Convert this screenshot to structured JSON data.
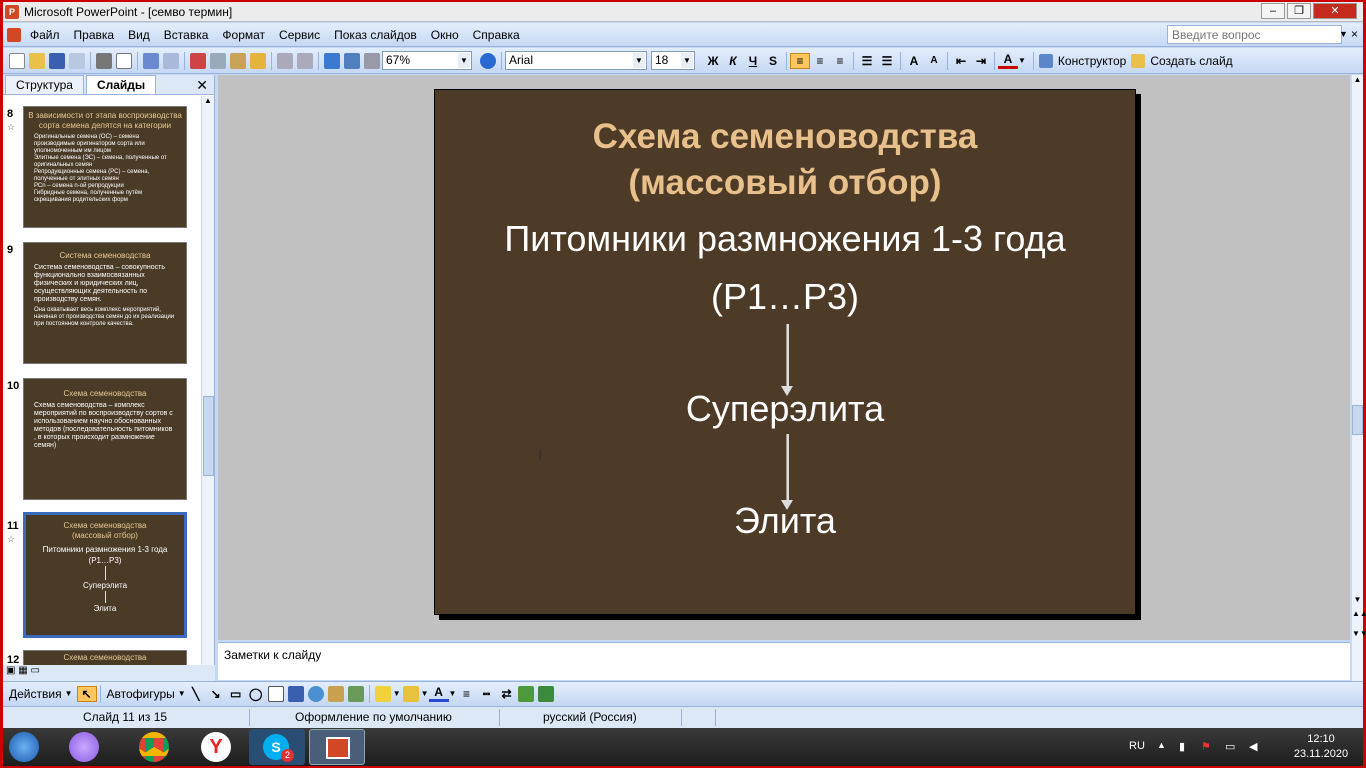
{
  "window": {
    "title": "Microsoft PowerPoint - [семво термин]",
    "app_icon": "powerpoint-icon"
  },
  "window_controls": {
    "minimize": "–",
    "restore": "❐",
    "close": "✕"
  },
  "menubar": {
    "items": [
      "Файл",
      "Правка",
      "Вид",
      "Вставка",
      "Формат",
      "Сервис",
      "Показ слайдов",
      "Окно",
      "Справка"
    ],
    "help_placeholder": "Введите вопрос",
    "close": "×"
  },
  "toolbar": {
    "zoom": "67%",
    "font": "Arial",
    "font_size": "18",
    "bold": "Ж",
    "italic": "К",
    "underline": "Ч",
    "shadow": "S",
    "designer": "Конструктор",
    "new_slide": "Создать слайд"
  },
  "panel": {
    "tab_outline": "Структура",
    "tab_slides": "Слайды",
    "close": "✕",
    "slides": [
      {
        "number": "8",
        "star": "☆",
        "title": "В зависимости от этапа воспроизводства сорта семена делятся на категории",
        "body": [
          "Оригинальные семена (ОС) – семена производимые оригинатором сорта или уполномоченным им лицом",
          "Элитные семена (ЭС) – семена, полученные от оригинальных семян",
          "Репродукционные семена (РС) – семена, полученные от элитных семян",
          "РСn – семена n-ой репродукции",
          "Гибридные семена, полученные путём скрещивания родительских форм"
        ]
      },
      {
        "number": "9",
        "title": "Система семеноводства",
        "body": [
          "Система семеноводства – совокупность функционально взаимосвязанных физических и юридических лиц, осуществляющих деятельность по производству семян.",
          "Она охватывает весь комплекс мероприятий, начиная от производства семян до их реализации при постоянном контроле качества."
        ]
      },
      {
        "number": "10",
        "title": "Схема семеноводства",
        "body": [
          "Схема семеноводства – комплекс мероприятий по воспроизводству сортов с использованием научно обоснованных методов (последовательность питомников , в которых происходит размножение семян)"
        ]
      },
      {
        "number": "11",
        "star": "☆",
        "title": "Схема семеноводства (массовый отбор)",
        "lines": [
          "Питомники размножения 1-3 года",
          "(Р1…Р3)",
          "Суперэлита",
          "Элита"
        ]
      },
      {
        "number": "12",
        "title": "Схема семеноводства"
      }
    ]
  },
  "slide": {
    "title_line1": "Схема семеноводства",
    "title_line2": "(массовый отбор)",
    "line1": "Питомники размножения 1-3 года",
    "line2": "(Р1…Р3)",
    "line3": "Суперэлита",
    "line4": "Элита"
  },
  "notes": {
    "placeholder": "Заметки к слайду"
  },
  "drawbar": {
    "actions": "Действия",
    "autoshapes": "Автофигуры"
  },
  "status": {
    "slide": "Слайд 11 из 15",
    "design": "Оформление по умолчанию",
    "language": "русский (Россия)"
  },
  "taskbar": {
    "lang": "RU",
    "time": "12:10",
    "date": "23.11.2020",
    "skype_badge": "2"
  },
  "colors": {
    "slide_bg": "#4d3b27",
    "slide_title": "#e7c08c",
    "accent": "#3b6bbf"
  }
}
